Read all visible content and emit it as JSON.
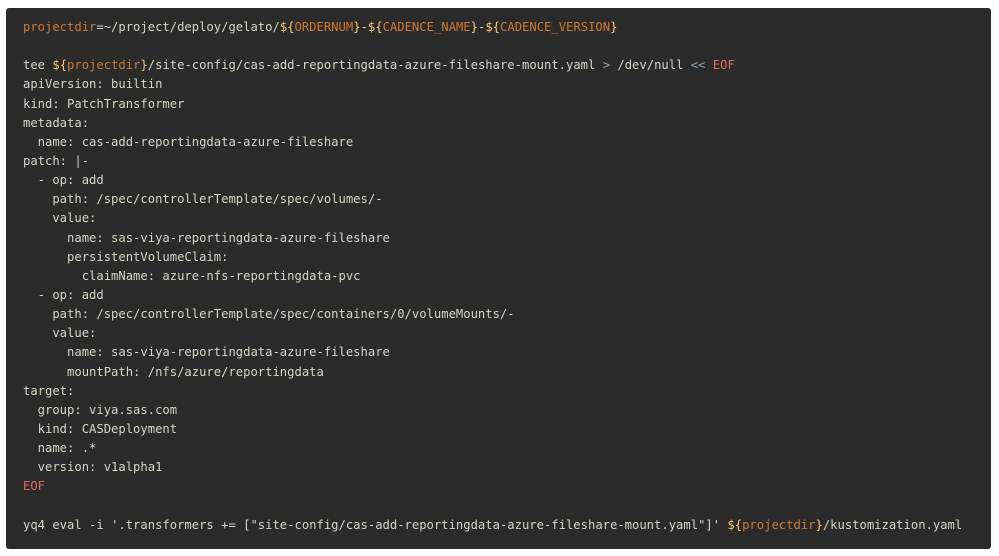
{
  "code": {
    "lines": [
      [
        {
          "t": "var",
          "v": "projectdir"
        },
        {
          "t": "plain",
          "v": "=~/project/deploy/gelato/"
        },
        {
          "t": "punct",
          "v": "${"
        },
        {
          "t": "var",
          "v": "ORDERNUM"
        },
        {
          "t": "punct",
          "v": "}"
        },
        {
          "t": "plain",
          "v": "-"
        },
        {
          "t": "punct",
          "v": "${"
        },
        {
          "t": "var",
          "v": "CADENCE_NAME"
        },
        {
          "t": "punct",
          "v": "}"
        },
        {
          "t": "plain",
          "v": "-"
        },
        {
          "t": "punct",
          "v": "${"
        },
        {
          "t": "var",
          "v": "CADENCE_VERSION"
        },
        {
          "t": "punct",
          "v": "}"
        }
      ],
      [],
      [
        {
          "t": "plain",
          "v": "tee "
        },
        {
          "t": "punct",
          "v": "${"
        },
        {
          "t": "var",
          "v": "projectdir"
        },
        {
          "t": "punct",
          "v": "}"
        },
        {
          "t": "plain",
          "v": "/site-config/cas-add-reportingdata-azure-fileshare-mount.yaml "
        },
        {
          "t": "op",
          "v": ">"
        },
        {
          "t": "plain",
          "v": " /dev/null "
        },
        {
          "t": "op",
          "v": "<<"
        },
        {
          "t": "plain",
          "v": " "
        },
        {
          "t": "kw",
          "v": "EOF"
        }
      ],
      [
        {
          "t": "plain",
          "v": "apiVersion: builtin"
        }
      ],
      [
        {
          "t": "plain",
          "v": "kind: PatchTransformer"
        }
      ],
      [
        {
          "t": "plain",
          "v": "metadata:"
        }
      ],
      [
        {
          "t": "plain",
          "v": "  name: cas-add-reportingdata-azure-fileshare"
        }
      ],
      [
        {
          "t": "plain",
          "v": "patch: |-"
        }
      ],
      [
        {
          "t": "plain",
          "v": "  - op: add"
        }
      ],
      [
        {
          "t": "plain",
          "v": "    path: /spec/controllerTemplate/spec/volumes/-"
        }
      ],
      [
        {
          "t": "plain",
          "v": "    value:"
        }
      ],
      [
        {
          "t": "plain",
          "v": "      name: sas-viya-reportingdata-azure-fileshare"
        }
      ],
      [
        {
          "t": "plain",
          "v": "      persistentVolumeClaim:"
        }
      ],
      [
        {
          "t": "plain",
          "v": "        claimName: azure-nfs-reportingdata-pvc"
        }
      ],
      [
        {
          "t": "plain",
          "v": "  - op: add"
        }
      ],
      [
        {
          "t": "plain",
          "v": "    path: /spec/controllerTemplate/spec/containers/0/volumeMounts/-"
        }
      ],
      [
        {
          "t": "plain",
          "v": "    value:"
        }
      ],
      [
        {
          "t": "plain",
          "v": "      name: sas-viya-reportingdata-azure-fileshare"
        }
      ],
      [
        {
          "t": "plain",
          "v": "      mountPath: /nfs/azure/reportingdata"
        }
      ],
      [
        {
          "t": "plain",
          "v": "target:"
        }
      ],
      [
        {
          "t": "plain",
          "v": "  group: viya.sas.com"
        }
      ],
      [
        {
          "t": "plain",
          "v": "  kind: CASDeployment"
        }
      ],
      [
        {
          "t": "plain",
          "v": "  name: .*"
        }
      ],
      [
        {
          "t": "plain",
          "v": "  version: v1alpha1"
        }
      ],
      [
        {
          "t": "kw",
          "v": "EOF"
        }
      ],
      [],
      [
        {
          "t": "plain",
          "v": "yq4 eval -i '.transformers += [\"site-config/cas-add-reportingdata-azure-fileshare-mount.yaml\"]' "
        },
        {
          "t": "punct",
          "v": "${"
        },
        {
          "t": "var",
          "v": "projectdir"
        },
        {
          "t": "punct",
          "v": "}"
        },
        {
          "t": "plain",
          "v": "/kustomization.yaml"
        }
      ]
    ]
  },
  "colors": {
    "background": "#2b2b2b",
    "variable": "#cc7832",
    "brace": "#ffc66d",
    "keyword": "#e06c5c",
    "text": "#d4d4c8"
  }
}
